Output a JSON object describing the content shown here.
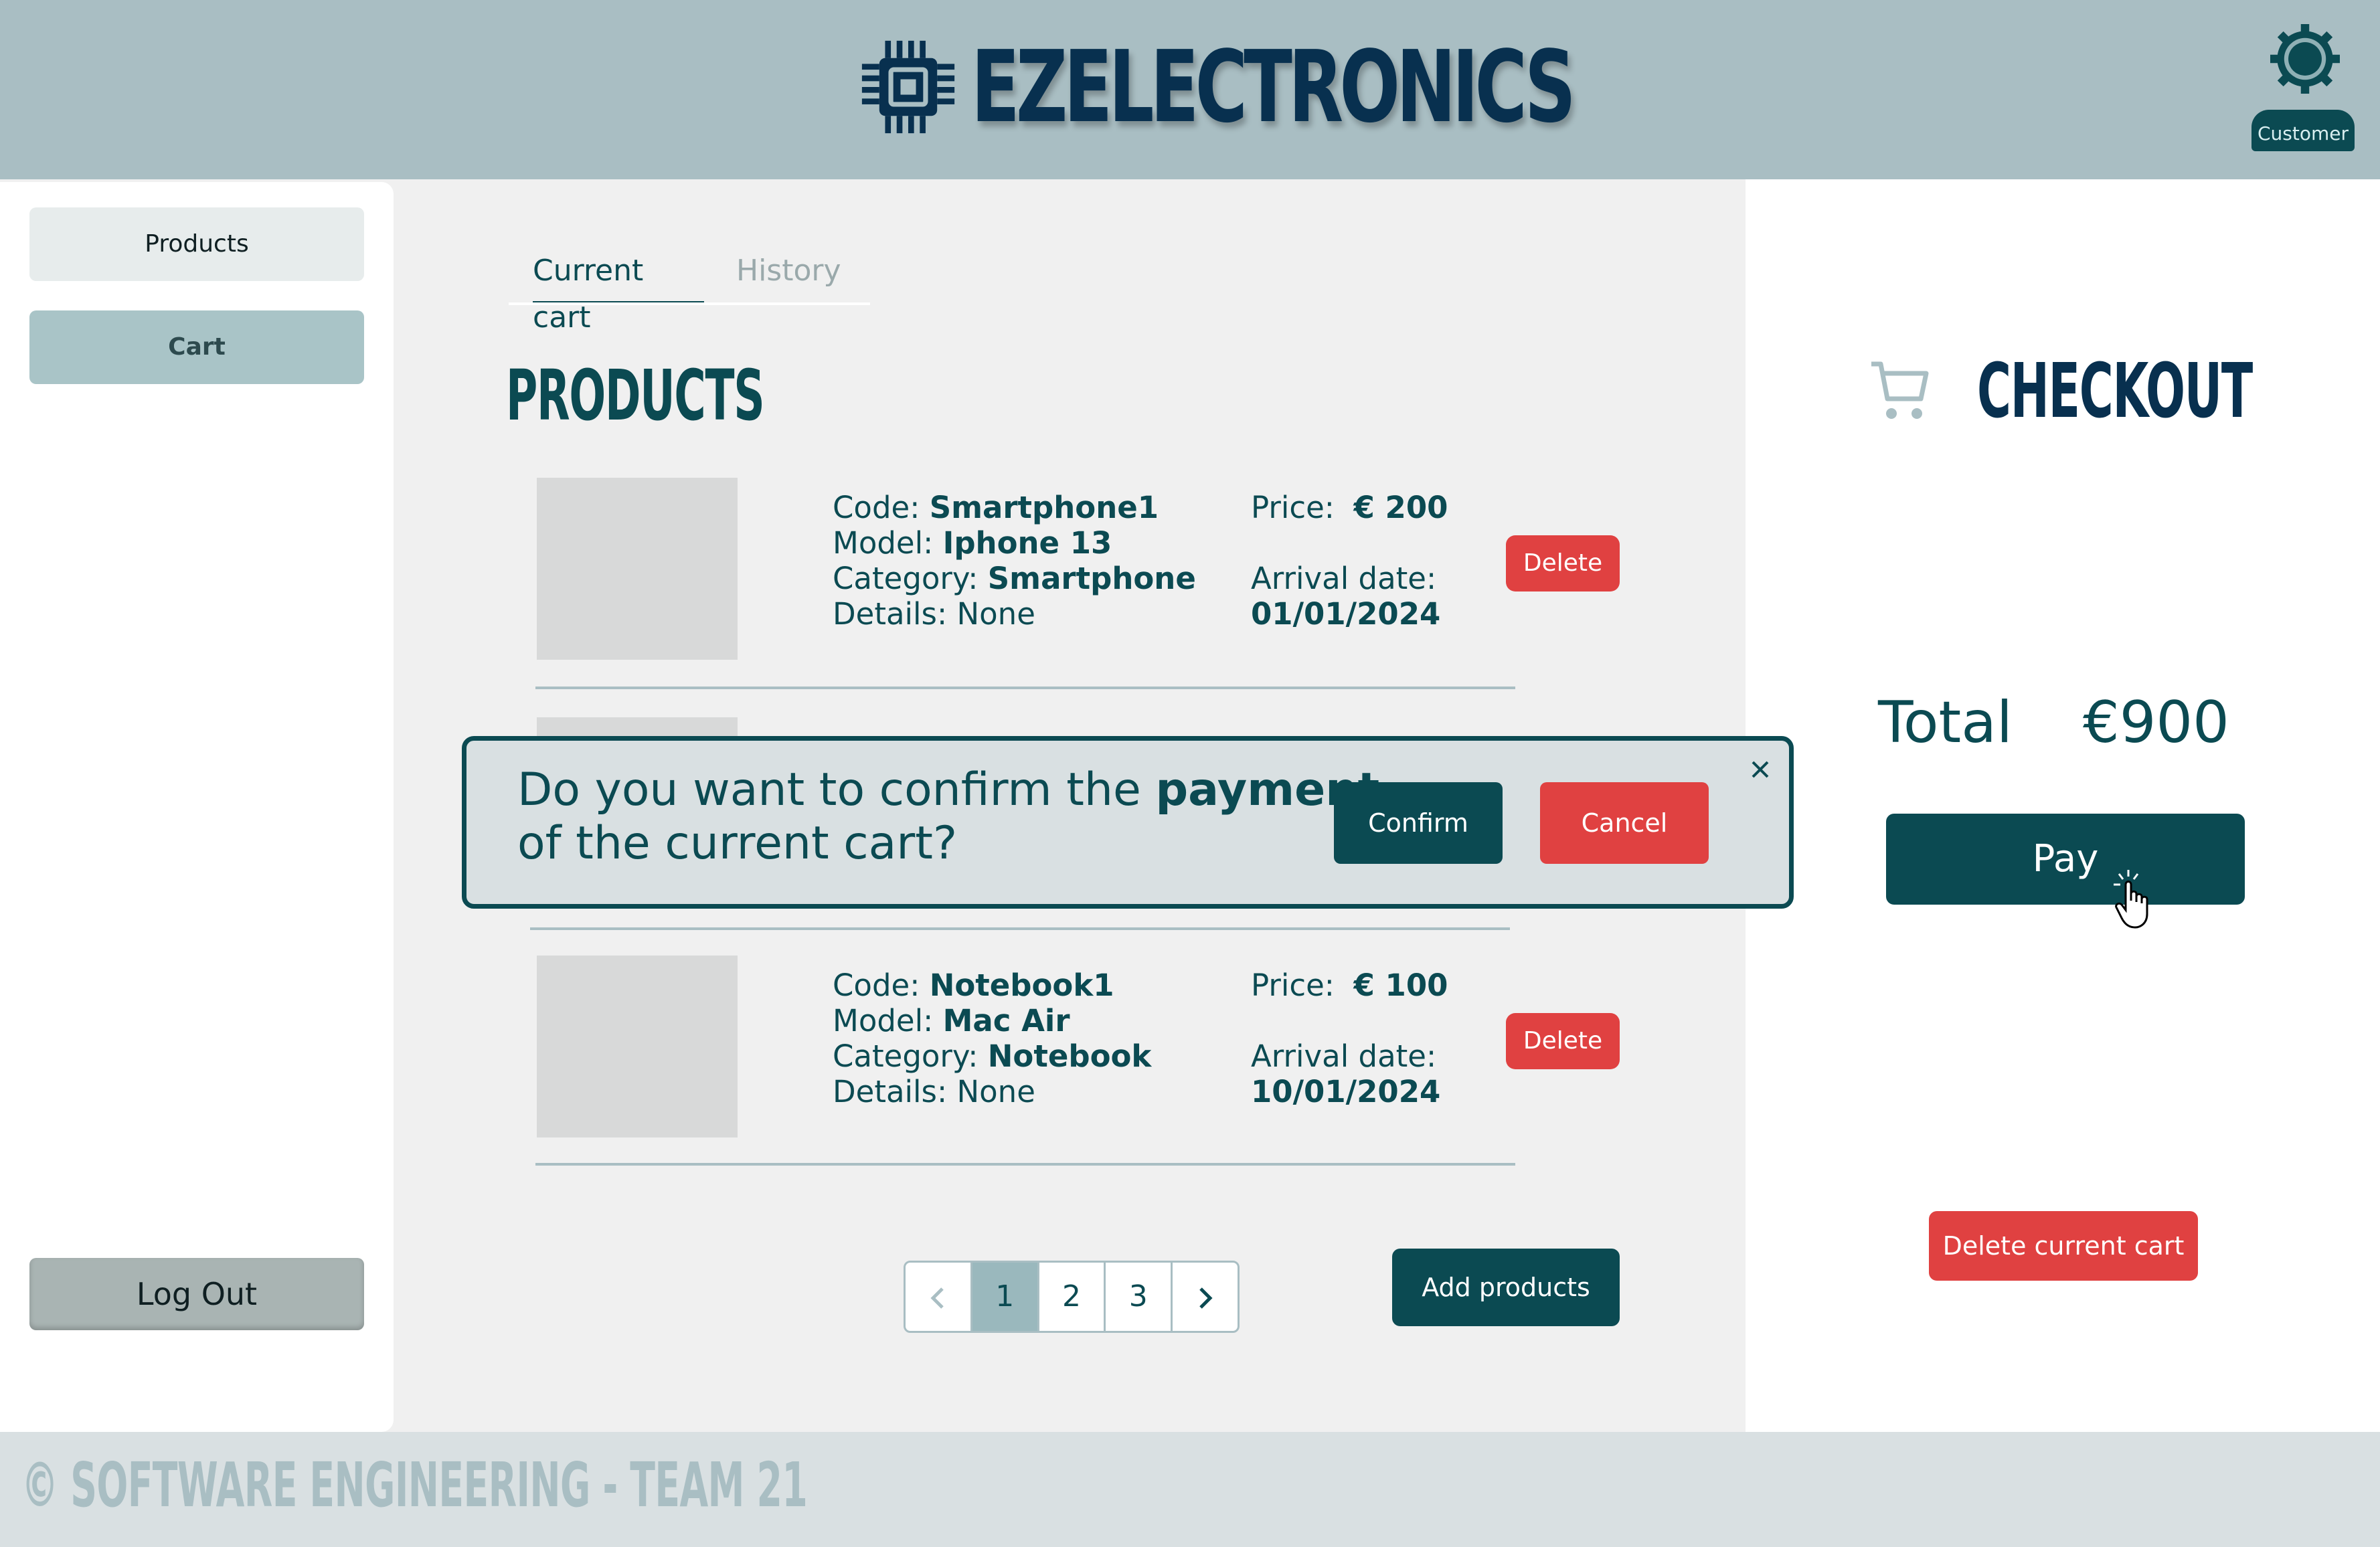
{
  "header": {
    "brand": "EZELECTRONICS",
    "user_role": "Customer"
  },
  "sidebar": {
    "items": [
      {
        "label": "Products"
      },
      {
        "label": "Cart"
      }
    ],
    "logout_label": "Log Out"
  },
  "tabs": [
    {
      "label": "Current cart"
    },
    {
      "label": "History"
    }
  ],
  "main": {
    "title": "PRODUCTS",
    "products": [
      {
        "code_label": "Code:",
        "code": "Smartphone1",
        "model_label": "Model:",
        "model": "Iphone 13",
        "category_label": "Category:",
        "category": "Smartphone",
        "details_label": "Details:",
        "details": "None",
        "price_label": "Price:",
        "price": "€ 200",
        "arrival_label": "Arrival date:",
        "arrival": "01/01/2024",
        "delete_label": "Delete"
      },
      {
        "code_label": "Code:",
        "code": "Notebook1",
        "model_label": "Model:",
        "model": "Mac Air",
        "category_label": "Category:",
        "category": "Notebook",
        "details_label": "Details:",
        "details": "None",
        "price_label": "Price:",
        "price": "€ 100",
        "arrival_label": "Arrival date:",
        "arrival": "10/01/2024",
        "delete_label": "Delete"
      }
    ],
    "pagination": {
      "pages": [
        "1",
        "2",
        "3"
      ],
      "current": "1"
    },
    "add_products_label": "Add products"
  },
  "checkout": {
    "title": "CHECKOUT",
    "total_label": "Total",
    "total_value": "€900",
    "pay_label": "Pay",
    "delete_cart_label": "Delete current cart"
  },
  "modal": {
    "text_before": "Do you want to confirm the ",
    "text_bold": "payment",
    "text_after": "of the current cart?",
    "confirm_label": "Confirm",
    "cancel_label": "Cancel"
  },
  "footer": {
    "text": "© SOFTWARE ENGINEERING - TEAM 21"
  },
  "colors": {
    "primary": "#0b4a52",
    "header_bg": "#a9bec3",
    "danger": "#e04141",
    "brand_text": "#08304f"
  }
}
